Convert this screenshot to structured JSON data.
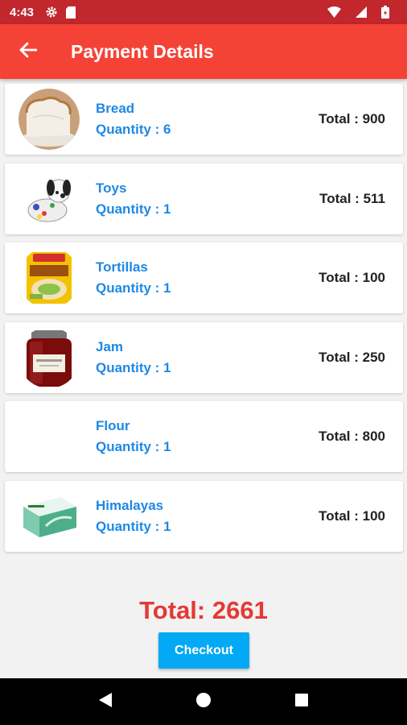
{
  "status_bar": {
    "time": "4:43",
    "left_icons": [
      "gear-icon",
      "sd-card-icon"
    ],
    "right_icons": [
      "wifi-icon",
      "signal-icon",
      "battery-icon"
    ]
  },
  "app_bar": {
    "title": "Payment Details",
    "back_icon": "arrow-back-icon",
    "color": "#f44336"
  },
  "items": [
    {
      "name": "Bread",
      "quantity": "Quantity : 6",
      "total": "Total : 900"
    },
    {
      "name": "Toys",
      "quantity": "Quantity : 1",
      "total": "Total : 511"
    },
    {
      "name": "Tortillas",
      "quantity": "Quantity : 1",
      "total": "Total : 100"
    },
    {
      "name": "Jam",
      "quantity": "Quantity : 1",
      "total": "Total : 250"
    },
    {
      "name": "Flour",
      "quantity": "Quantity : 1",
      "total": "Total : 800"
    },
    {
      "name": "Himalayas",
      "quantity": "Quantity : 1",
      "total": "Total : 100"
    }
  ],
  "summary": {
    "total": "Total: 2661",
    "checkout_label": "Checkout",
    "total_color": "#e53935",
    "checkout_color": "#03a9f4"
  },
  "nav_bar": {
    "buttons": [
      "back-triangle-icon",
      "home-circle-icon",
      "recents-square-icon"
    ]
  }
}
